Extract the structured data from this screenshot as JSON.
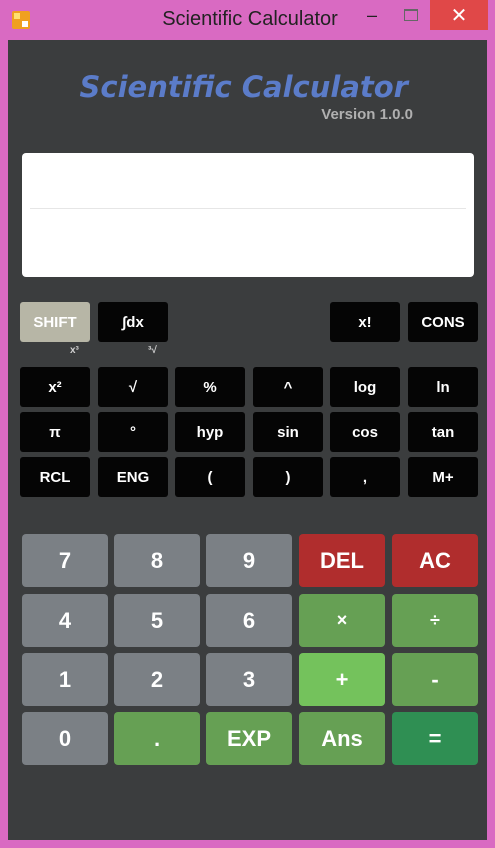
{
  "window": {
    "title": "Scientific Calculator",
    "minimize_glyph": "–",
    "close_glyph": "✕"
  },
  "app": {
    "heading": "Scientific Calculator",
    "version": "Version 1.0.0"
  },
  "display": {
    "expression": "",
    "result": ""
  },
  "function_row0": {
    "shift": "SHIFT",
    "integral": "∫dx",
    "factorial": "x!",
    "cons": "CONS"
  },
  "shift_labels": {
    "cube": "x³",
    "cube_root": "³√"
  },
  "function_row1": [
    "x²",
    "√",
    "%",
    "^",
    "log",
    "ln"
  ],
  "function_row2": [
    "π",
    "°",
    "hyp",
    "sin",
    "cos",
    "tan"
  ],
  "function_row3": [
    "RCL",
    "ENG",
    "(",
    ")",
    ",",
    "M+"
  ],
  "keypad": {
    "row1": [
      "7",
      "8",
      "9",
      "DEL",
      "AC"
    ],
    "row2": [
      "4",
      "5",
      "6",
      "×",
      "÷"
    ],
    "row3": [
      "1",
      "2",
      "3",
      "+",
      "-"
    ],
    "row4": [
      "0",
      ".",
      "EXP",
      "Ans",
      "="
    ]
  },
  "colors": {
    "window_frame": "#d96ac2",
    "body_bg": "#3b3d3e",
    "title_accent": "#5b7cc9",
    "number_key": "#7b8085",
    "delete_key": "#b02d2d",
    "operator_key": "#66a054",
    "equals_key": "#2f8f53",
    "function_key": "#050505"
  }
}
